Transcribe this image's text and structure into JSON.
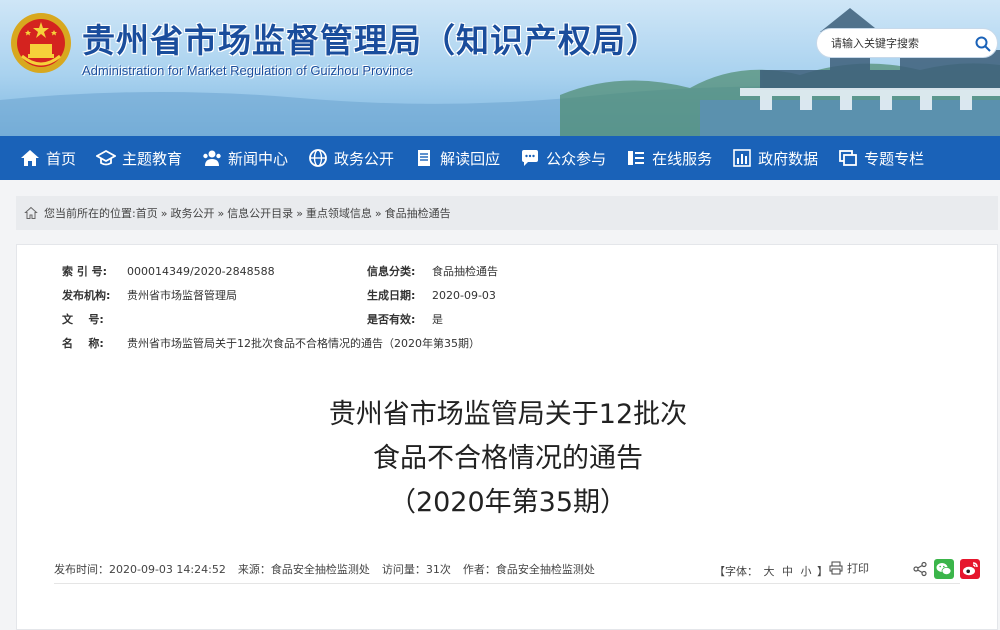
{
  "header": {
    "title": "贵州省市场监督管理局（知识产权局）",
    "subtitle": "Administration for Market Regulation of Guizhou Province",
    "search_placeholder": "请输入关键字搜索"
  },
  "nav": {
    "items": [
      {
        "label": "首页",
        "icon": "home-icon"
      },
      {
        "label": "主题教育",
        "icon": "graduation-cap-icon"
      },
      {
        "label": "新闻中心",
        "icon": "users-icon"
      },
      {
        "label": "政务公开",
        "icon": "globe-icon"
      },
      {
        "label": "解读回应",
        "icon": "document-icon"
      },
      {
        "label": "公众参与",
        "icon": "chat-icon"
      },
      {
        "label": "在线服务",
        "icon": "list-icon"
      },
      {
        "label": "政府数据",
        "icon": "bar-chart-icon"
      },
      {
        "label": "专题专栏",
        "icon": "windows-icon"
      }
    ]
  },
  "breadcrumb": {
    "prefix": "您当前所在的位置:",
    "items": [
      "首页",
      "政务公开",
      "信息公开目录",
      "重点领域信息",
      "食品抽检通告"
    ],
    "separator": "»"
  },
  "meta": {
    "index_label": "索 引 号:",
    "index_value": "000014349/2020-2848588",
    "category_label": "信息分类:",
    "category_value": "食品抽检通告",
    "publisher_label": "发布机构:",
    "publisher_value": "贵州省市场监督管理局",
    "date_label": "生成日期:",
    "date_value": "2020-09-03",
    "docno_label": "文    号:",
    "docno_value": "",
    "valid_label": "是否有效:",
    "valid_value": "是",
    "name_label": "名    称:",
    "name_value": "贵州省市场监管局关于12批次食品不合格情况的通告（2020年第35期）"
  },
  "document": {
    "title_line1": "贵州省市场监管局关于12批次",
    "title_line2": "食品不合格情况的通告",
    "title_line3": "（2020年第35期）"
  },
  "info_bar": {
    "publish_time": "发布时间：2020-09-03 14:24:52",
    "source": "来源：食品安全抽检监测处",
    "views": "访问量：31次",
    "author": "作者：食品安全抽检监测处",
    "font_label": "【字体：",
    "font_large": "大",
    "font_medium": "中",
    "font_small": "小",
    "font_end": "】",
    "print_label": "打印"
  },
  "colors": {
    "nav_bg": "#1a62b8",
    "title_blue": "#1a4d9c",
    "wechat_green": "#3bb54a",
    "weibo_red": "#e6162d"
  }
}
